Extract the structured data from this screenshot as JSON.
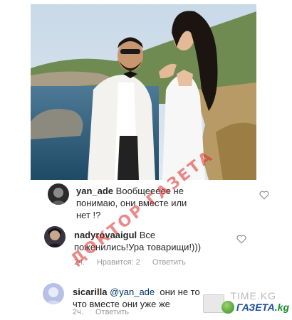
{
  "watermark": "ДОКТОР ГАЗЕТА",
  "brand": {
    "time_label": "TIME.KG",
    "gazeta_label": "ГАЗЕТА",
    "gazeta_suffix": ".kg"
  },
  "comments": [
    {
      "username": "yan_ade",
      "text": "Вообщеееее не понимаю, они вместе или нет !?",
      "line1": "Вообщеееее не",
      "line2": "понимаю, они вместе или",
      "line3": "нет !?",
      "liked": false
    },
    {
      "username": "nadyrovaaigul",
      "text": "Все поженились!Ура товарищи!)))",
      "line1": "Все",
      "line2": "поженились!Ура товарищи!)))",
      "time": "2ч.",
      "likes": "Нравится: 2",
      "reply": "Ответить",
      "liked": false
    },
    {
      "username": "sicarilla",
      "mention": "@yan_ade",
      "line1_rest": "они не то",
      "line2": "что вместе они уже же",
      "time": "2ч.",
      "reply": "Ответить",
      "liked": false
    }
  ]
}
